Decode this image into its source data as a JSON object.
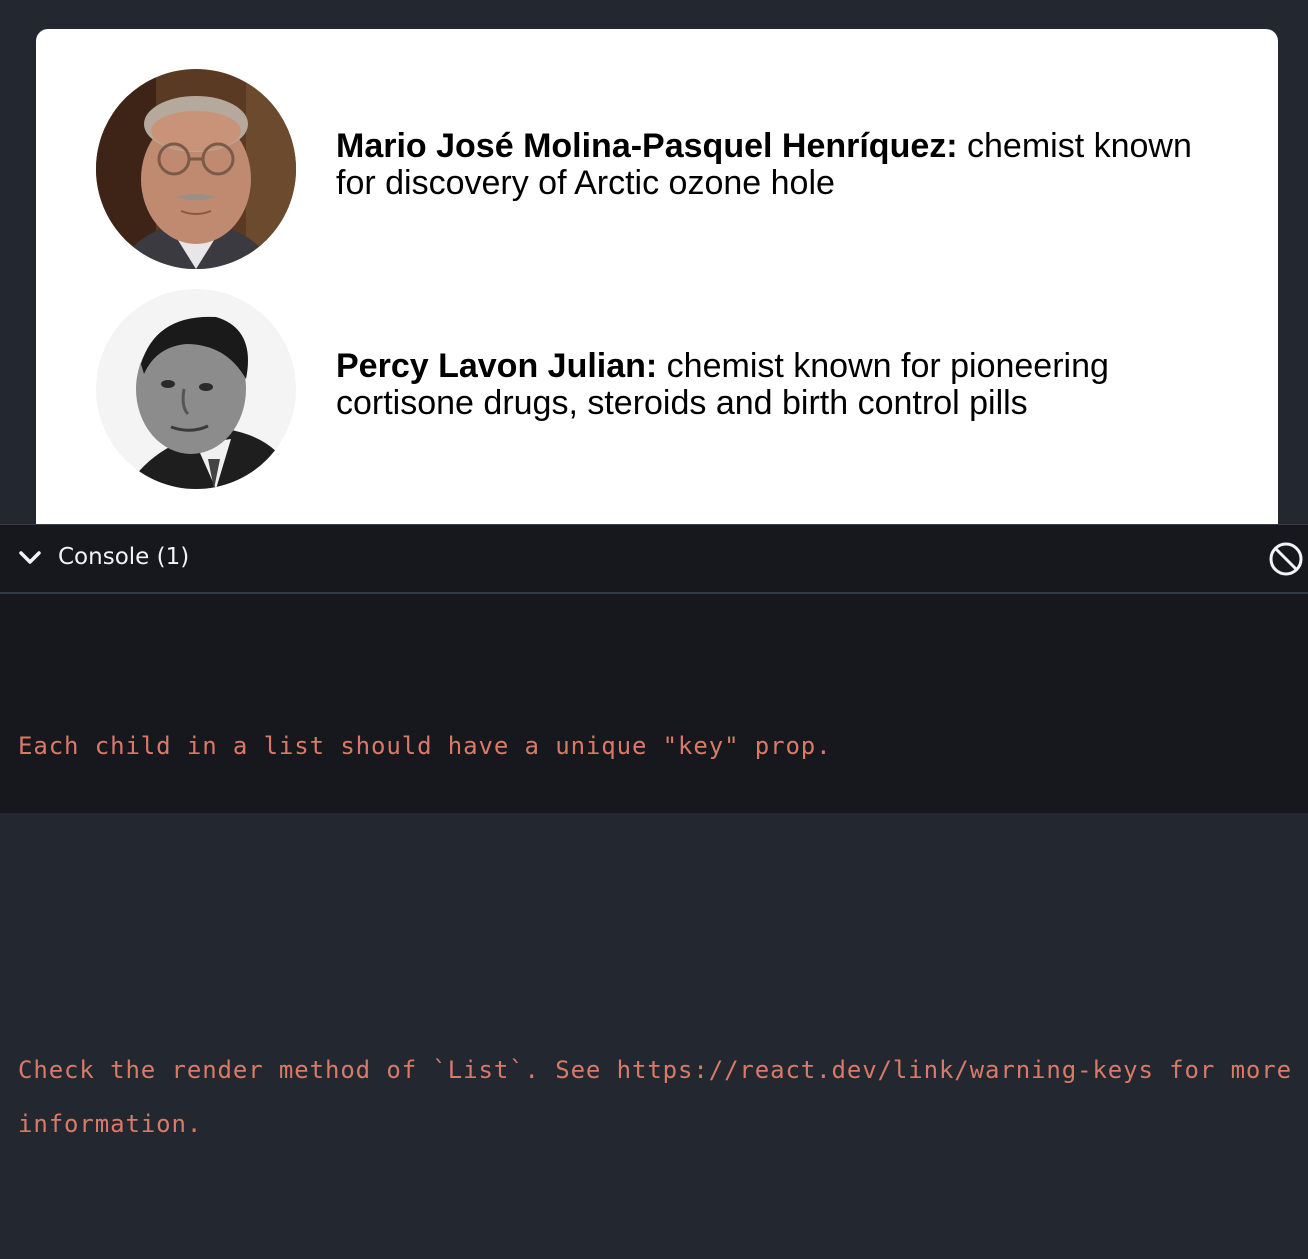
{
  "people": [
    {
      "name": "Mario José Molina-Pasquel Henríquez:",
      "description": " chemist known for discovery of Arctic ozone hole",
      "photo_alt": "Mario José Molina-Pasquel Henríquez"
    },
    {
      "name": "Percy Lavon Julian:",
      "description": " chemist known for pioneering cortisone drugs, steroids and birth control pills",
      "photo_alt": "Percy Lavon Julian"
    }
  ],
  "console": {
    "title": "Console (1)",
    "message_line1": "Each child in a list should have a unique \"key\" prop.",
    "message_line2": "Check the render method of `List`. See https://react.dev/link/warning-keys for more information."
  },
  "colors": {
    "page_bg": "#23272f",
    "console_bg": "#16181d",
    "error_text": "#d97a69"
  },
  "icons": {
    "collapse": "chevron-down-icon",
    "clear": "clear-console-icon"
  }
}
